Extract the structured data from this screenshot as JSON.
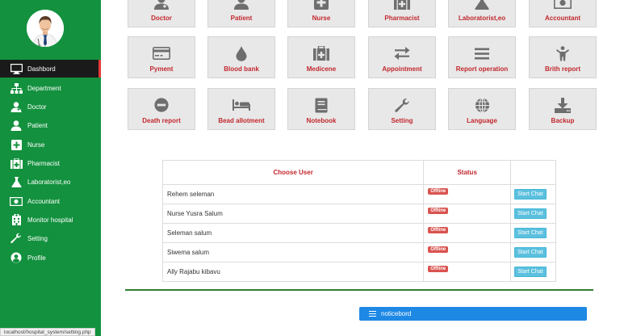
{
  "sidebar": {
    "items": [
      {
        "label": "Dashbord",
        "icon": "monitor-icon"
      },
      {
        "label": "Department",
        "icon": "sitemap-icon"
      },
      {
        "label": "Doctor",
        "icon": "user-md-icon"
      },
      {
        "label": "Patient",
        "icon": "user-icon"
      },
      {
        "label": "Nurse",
        "icon": "plus-square-icon"
      },
      {
        "label": "Pharmacist",
        "icon": "medkit-icon"
      },
      {
        "label": "Laboratorist,eo",
        "icon": "flask-icon"
      },
      {
        "label": "Accountant",
        "icon": "money-icon"
      },
      {
        "label": "Monitor hospital",
        "icon": "hospital-icon"
      },
      {
        "label": "Setting",
        "icon": "wrench-icon"
      },
      {
        "label": "Profile",
        "icon": "user-circle-icon"
      }
    ]
  },
  "tiles": [
    {
      "label": "Doctor",
      "icon": "user-md-icon"
    },
    {
      "label": "Patient",
      "icon": "user-icon"
    },
    {
      "label": "Nurse",
      "icon": "plus-square-icon"
    },
    {
      "label": "Pharmacist",
      "icon": "medkit-icon"
    },
    {
      "label": "Laboratorist,eo",
      "icon": "flask-icon"
    },
    {
      "label": "Accountant",
      "icon": "money-icon"
    },
    {
      "label": "Pyment",
      "icon": "credit-card-icon"
    },
    {
      "label": "Blood bank",
      "icon": "tint-icon"
    },
    {
      "label": "Medicene",
      "icon": "medkit-icon"
    },
    {
      "label": "Appointment",
      "icon": "exchange-icon"
    },
    {
      "label": "Report operation",
      "icon": "bars-icon"
    },
    {
      "label": "Brith report",
      "icon": "child-icon"
    },
    {
      "label": "Death report",
      "icon": "minus-circle-icon"
    },
    {
      "label": "Bead allotment",
      "icon": "bed-icon"
    },
    {
      "label": "Notebook",
      "icon": "book-icon"
    },
    {
      "label": "Setting",
      "icon": "wrench-icon"
    },
    {
      "label": "Language",
      "icon": "globe-icon"
    },
    {
      "label": "Backup",
      "icon": "download-icon"
    }
  ],
  "chat": {
    "col_user": "Choose User",
    "col_status": "Status",
    "col_action": "",
    "rows": [
      {
        "name": "Rehem seleman",
        "status": "Offline",
        "action": "Start Chat"
      },
      {
        "name": "Nurse Yusra Salum",
        "status": "Offline",
        "action": "Start Chat"
      },
      {
        "name": "Seleman salum",
        "status": "Offline",
        "action": "Start Chat"
      },
      {
        "name": "Siwema salum",
        "status": "Offline",
        "action": "Start Chat"
      },
      {
        "name": "Ally Rajabu kibavu",
        "status": "Offline",
        "action": "Start Chat"
      }
    ]
  },
  "noticeboard": {
    "label": "noticebord"
  },
  "statusbar": {
    "url": "localhost/hospital_system/setting.php"
  },
  "colors": {
    "sidebar": "#13913e",
    "accent": "#c2272d",
    "noticeboard": "#1e88e5",
    "chat_button": "#5bc0de",
    "offline_badge": "#d9534f"
  }
}
